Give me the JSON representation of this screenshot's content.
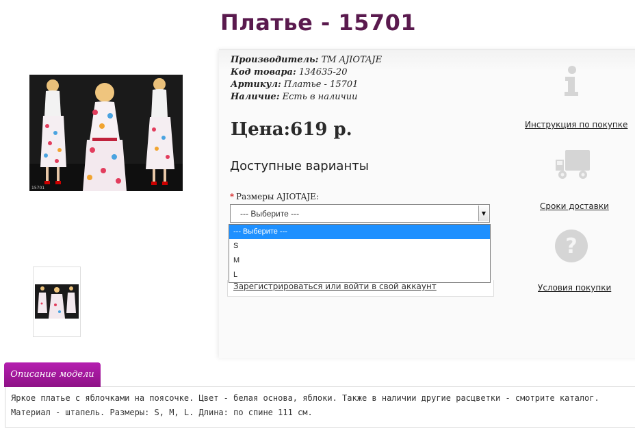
{
  "product": {
    "title": "Платье - 15701",
    "manufacturer_label": "Производитель:",
    "manufacturer_value": "ТМ AJIOTAJE",
    "code_label": "Код товара:",
    "code_value": "134635-20",
    "article_label": "Артикул:",
    "article_value": "Платье - 15701",
    "stock_label": "Наличие:",
    "stock_value": "Есть в наличии",
    "price": "Цена:619 р.",
    "image_caption": "15701"
  },
  "variants": {
    "heading": "Доступные варианты",
    "required_mark": "*",
    "size_label": "Размеры AJIOTAJE:",
    "selected": "--- Выберите ---",
    "options": [
      "--- Выберите ---",
      "S",
      "M",
      "L"
    ]
  },
  "account": {
    "link": "Зарегистрироваться или войти в свой аккаунт"
  },
  "sidebar": {
    "instruction": {
      "label": "Инструкция по покупке",
      "icon": "info-icon"
    },
    "delivery": {
      "label": "Сроки доставки",
      "icon": "truck-icon"
    },
    "terms": {
      "label": "Условия покупки",
      "icon": "question-icon"
    }
  },
  "description": {
    "tab_label": "Описание модели",
    "text": "Яркое платье с яблочками на поясочке. Цвет - белая основа, яблоки. Также в наличии другие расцветки - смотрите каталог. Материал - штапель. Размеры: S, M, L. Длина: по спине 111 см."
  },
  "colors": {
    "title": "#5a1a4e",
    "tab": "#a0169b",
    "dropdown_highlight": "#1e90ff"
  }
}
